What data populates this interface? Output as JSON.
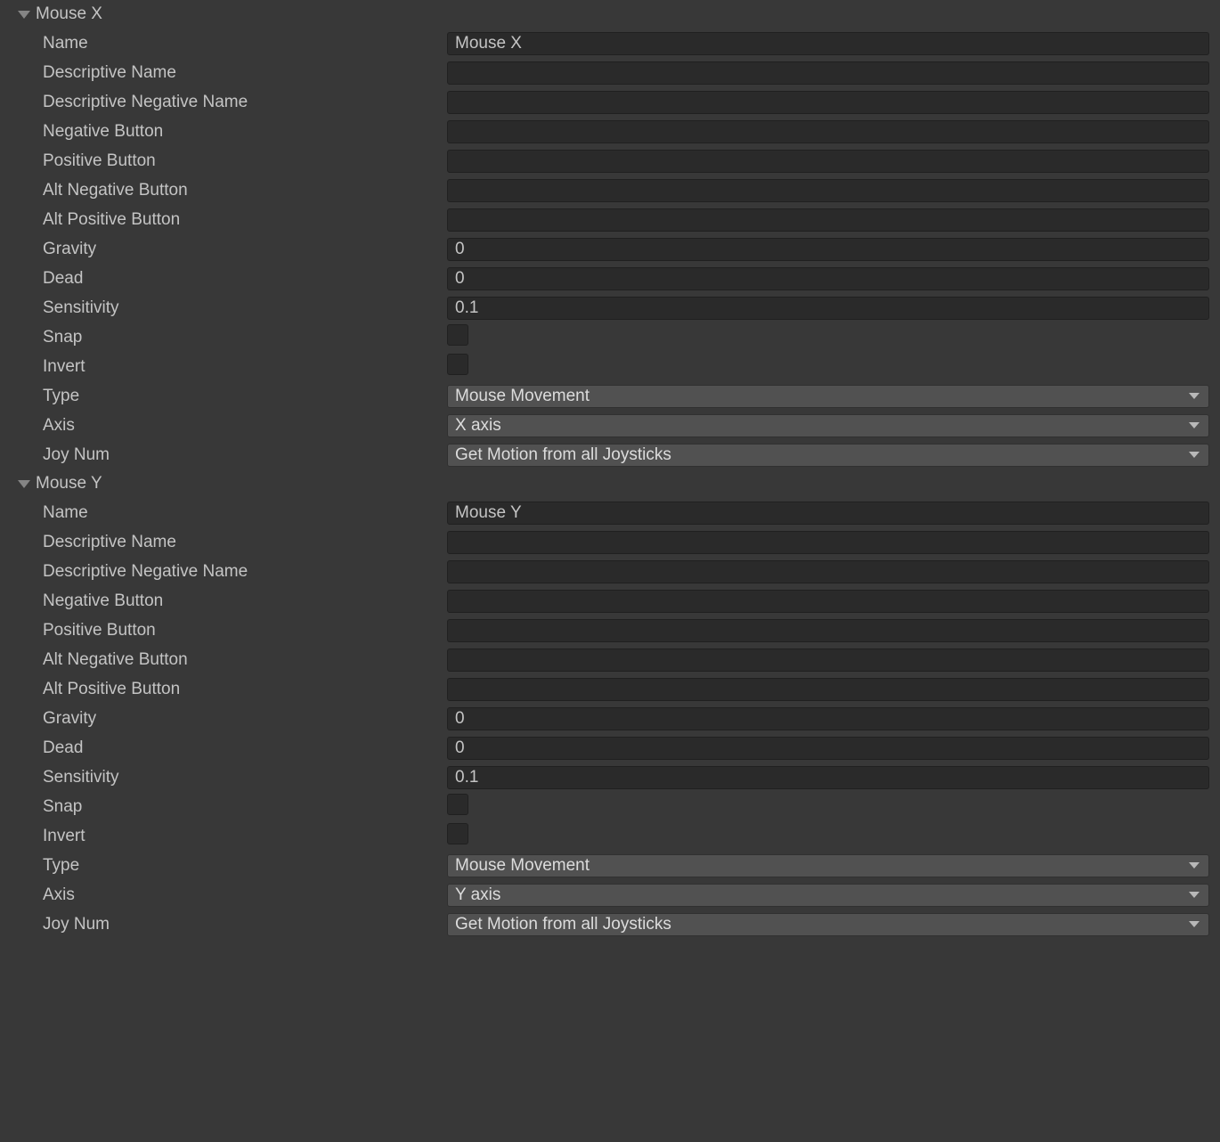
{
  "labels": {
    "name": "Name",
    "descriptiveName": "Descriptive Name",
    "descriptiveNegativeName": "Descriptive Negative Name",
    "negativeButton": "Negative Button",
    "positiveButton": "Positive Button",
    "altNegativeButton": "Alt Negative Button",
    "altPositiveButton": "Alt Positive Button",
    "gravity": "Gravity",
    "dead": "Dead",
    "sensitivity": "Sensitivity",
    "snap": "Snap",
    "invert": "Invert",
    "type": "Type",
    "axis": "Axis",
    "joyNum": "Joy Num"
  },
  "sections": [
    {
      "title": "Mouse X",
      "values": {
        "name": "Mouse X",
        "descriptiveName": "",
        "descriptiveNegativeName": "",
        "negativeButton": "",
        "positiveButton": "",
        "altNegativeButton": "",
        "altPositiveButton": "",
        "gravity": "0",
        "dead": "0",
        "sensitivity": "0.1",
        "snap": false,
        "invert": false,
        "type": "Mouse Movement",
        "axis": "X axis",
        "joyNum": "Get Motion from all Joysticks"
      }
    },
    {
      "title": "Mouse Y",
      "values": {
        "name": "Mouse Y",
        "descriptiveName": "",
        "descriptiveNegativeName": "",
        "negativeButton": "",
        "positiveButton": "",
        "altNegativeButton": "",
        "altPositiveButton": "",
        "gravity": "0",
        "dead": "0",
        "sensitivity": "0.1",
        "snap": false,
        "invert": false,
        "type": "Mouse Movement",
        "axis": "Y axis",
        "joyNum": "Get Motion from all Joysticks"
      }
    }
  ]
}
